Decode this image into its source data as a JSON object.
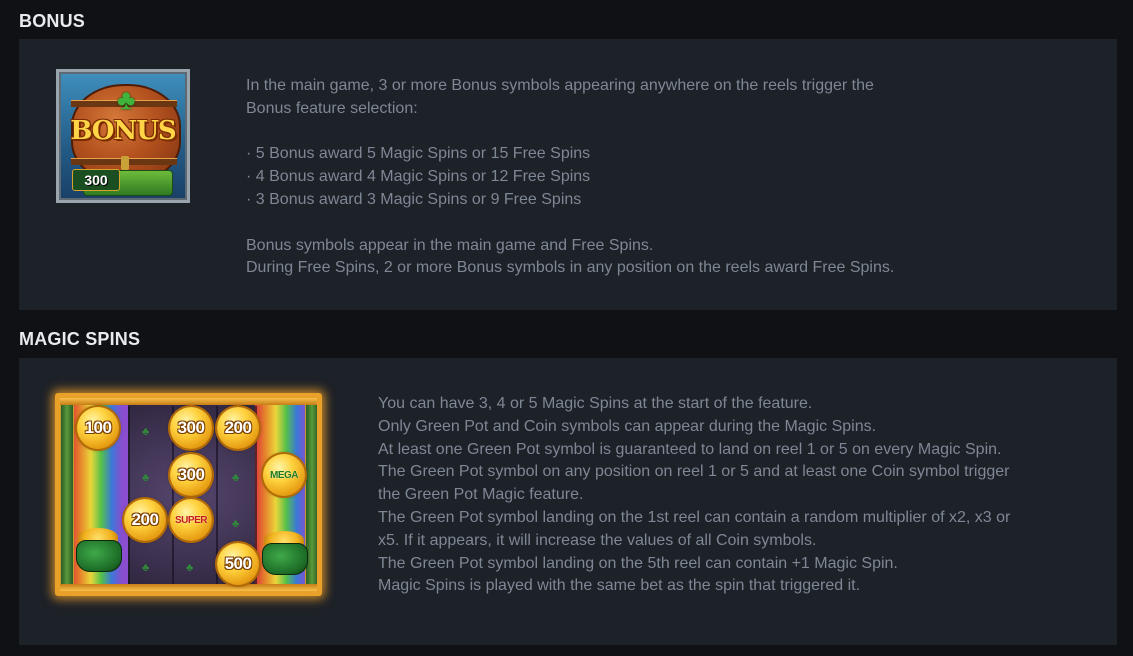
{
  "bonus": {
    "title": "BONUS",
    "symbol_text": "BONUS",
    "paragraphs": [
      "In the main game, 3 or more Bonus symbols appearing anywhere on the reels trigger the",
      "Bonus feature selection:",
      "",
      "· 5 Bonus award 5 Magic Spins or 15 Free Spins",
      "· 4 Bonus award 4 Magic Spins or 12 Free Spins",
      "· 3 Bonus award 3 Magic Spins or 9 Free Spins",
      "",
      "Bonus symbols appear in the main game and Free Spins.",
      "During Free Spins, 2 or more Bonus symbols in any position on the reels award Free Spins."
    ]
  },
  "magic_spins": {
    "title": "MAGIC SPINS",
    "coins": {
      "c1": "100",
      "c2": "300",
      "c3": "200",
      "c4": "300",
      "c5": "MEGA",
      "c6": "200",
      "c7": "SUPER",
      "c8": "500"
    },
    "pot_value": "300",
    "paragraphs": [
      "You can have 3, 4 or 5 Magic Spins at the start of the feature.",
      "Only Green Pot and Coin symbols can appear during the Magic Spins.",
      "At least one Green Pot symbol is guaranteed to land on reel 1 or 5 on every Magic Spin.",
      "The Green Pot symbol on any position on reel 1 or 5 and at least one Coin symbol trigger",
      "the Green Pot Magic feature.",
      "The Green Pot symbol landing on the 1st reel can contain a random multiplier of x2, x3 or",
      "x5. If it appears, it will increase the values of all Coin symbols.",
      "The Green Pot symbol landing on the 5th reel can contain +1 Magic Spin.",
      "Magic Spins is played with the same bet as the spin that triggered it."
    ]
  }
}
